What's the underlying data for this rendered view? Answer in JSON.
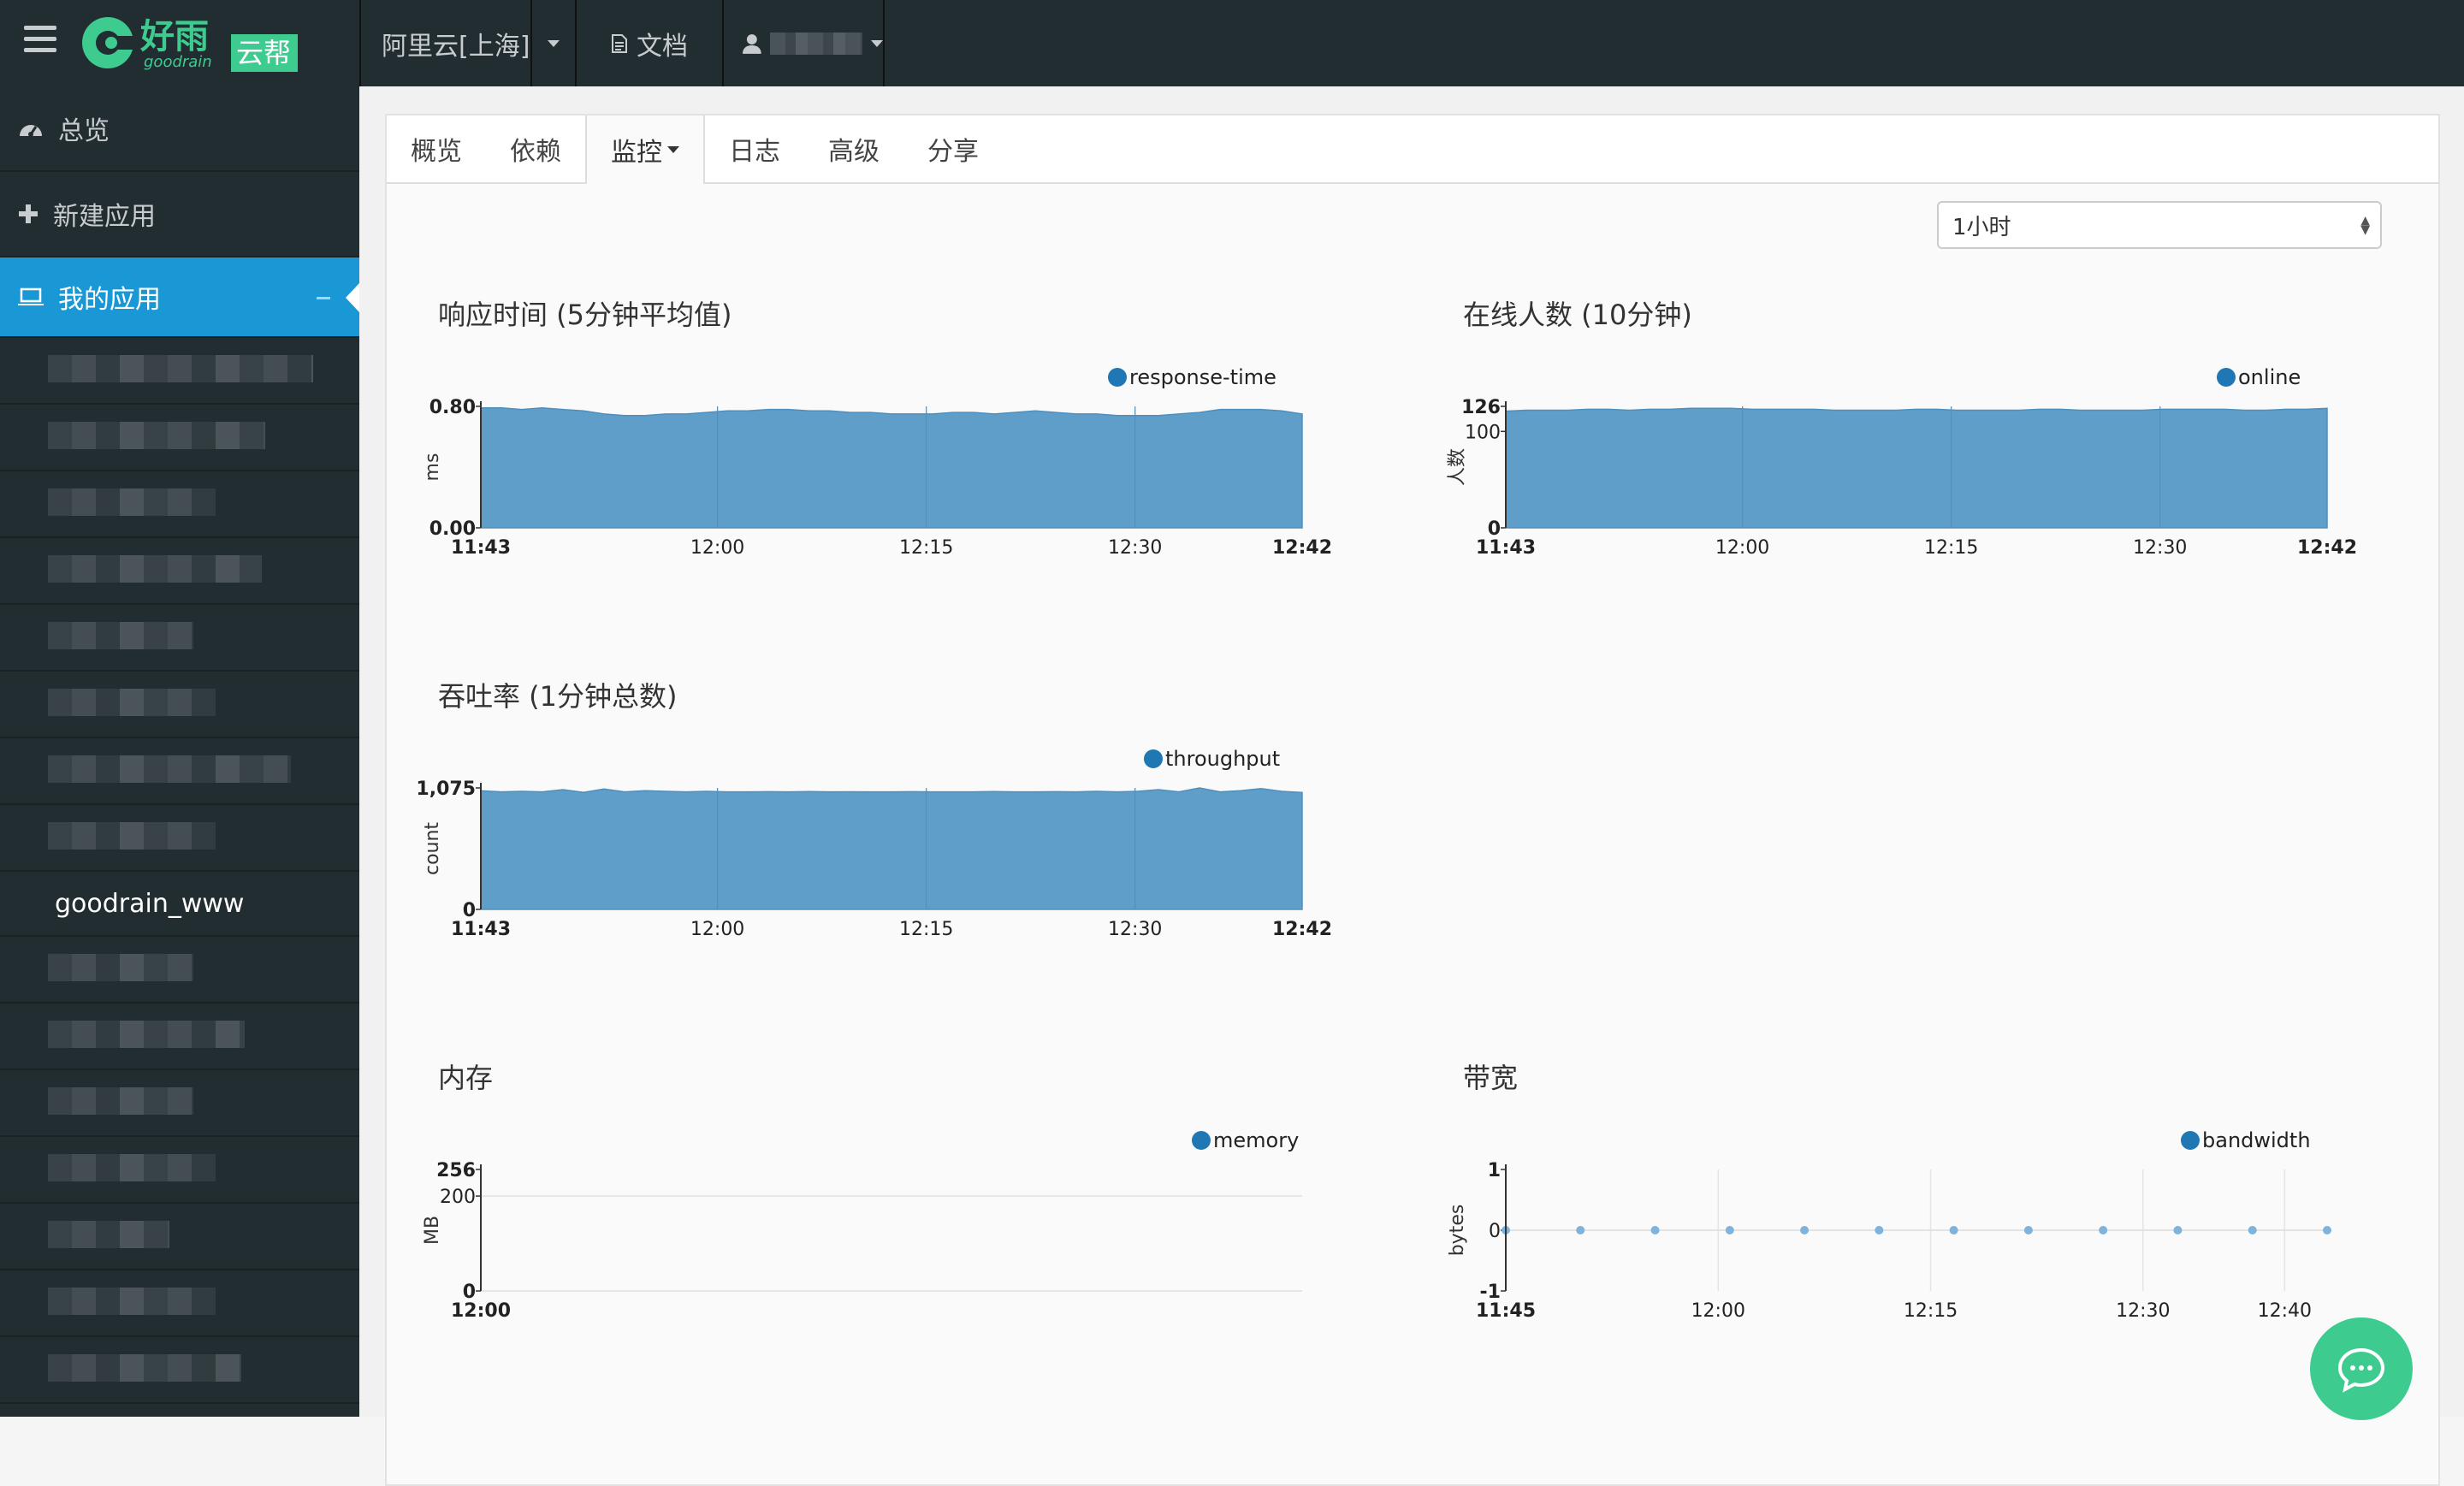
{
  "nav": {
    "region": "阿里云[上海]",
    "docs": "文档",
    "user": ""
  },
  "logo": {
    "text_cn": "好雨",
    "text_en": "goodrain",
    "badge": "云帮"
  },
  "sidebar": {
    "items": [
      {
        "label": "总览",
        "icon": "dashboard-icon"
      },
      {
        "label": "新建应用",
        "icon": "plus-icon"
      },
      {
        "label": "我的应用",
        "icon": "laptop-icon"
      }
    ],
    "visible_app": "goodrain_www"
  },
  "tabs": [
    {
      "label": "概览"
    },
    {
      "label": "依赖"
    },
    {
      "label": "监控"
    },
    {
      "label": "日志"
    },
    {
      "label": "高级"
    },
    {
      "label": "分享"
    }
  ],
  "time_range": {
    "selected": "1小时"
  },
  "colors": {
    "series": "#1f77b4",
    "area_fill": "#5f9ec8",
    "sidebar_active": "#1a98d5",
    "chat": "#3ecb8f"
  },
  "chart_data": [
    {
      "type": "area",
      "title": "响应时间 (5分钟平均值)",
      "ylabel": "ms",
      "legend": "response-time",
      "ylim": [
        0,
        0.8
      ],
      "y_ticks": [
        "0.80",
        "0.00"
      ],
      "x_ticks": [
        "11:43",
        "12:00",
        "12:15",
        "12:30",
        "12:42"
      ],
      "x_range_min": [
        703,
        762
      ],
      "series": [
        {
          "name": "response-time",
          "values": [
            0.79,
            0.79,
            0.78,
            0.79,
            0.78,
            0.77,
            0.75,
            0.74,
            0.74,
            0.75,
            0.75,
            0.76,
            0.77,
            0.77,
            0.78,
            0.78,
            0.77,
            0.77,
            0.76,
            0.76,
            0.75,
            0.75,
            0.75,
            0.76,
            0.76,
            0.75,
            0.76,
            0.77,
            0.76,
            0.75,
            0.75,
            0.74,
            0.74,
            0.74,
            0.75,
            0.76,
            0.78,
            0.78,
            0.78,
            0.77,
            0.75
          ]
        }
      ]
    },
    {
      "type": "area",
      "title": "在线人数 (10分钟)",
      "ylabel": "人数",
      "legend": "online",
      "ylim": [
        0,
        126
      ],
      "y_ticks": [
        "126",
        "100",
        "0"
      ],
      "x_ticks": [
        "11:43",
        "12:00",
        "12:15",
        "12:30",
        "12:42"
      ],
      "x_range_min": [
        703,
        762
      ],
      "series": [
        {
          "name": "online",
          "values": [
            121,
            122,
            122,
            122,
            123,
            123,
            122,
            123,
            123,
            124,
            124,
            124,
            123,
            123,
            123,
            123,
            122,
            122,
            122,
            122,
            123,
            123,
            122,
            122,
            122,
            122,
            123,
            123,
            122,
            122,
            122,
            122,
            123,
            123,
            123,
            123,
            122,
            122,
            123,
            123,
            124
          ]
        }
      ]
    },
    {
      "type": "area",
      "title": "吞吐率 (1分钟总数)",
      "ylabel": "count",
      "legend": "throughput",
      "ylim": [
        0,
        1075
      ],
      "y_ticks": [
        "1,075",
        "0"
      ],
      "x_ticks": [
        "11:43",
        "12:00",
        "12:15",
        "12:30",
        "12:42"
      ],
      "x_range_min": [
        703,
        762
      ],
      "series": [
        {
          "name": "throughput",
          "values": [
            1050,
            1040,
            1045,
            1040,
            1060,
            1035,
            1065,
            1040,
            1050,
            1045,
            1040,
            1045,
            1040,
            1040,
            1042,
            1040,
            1043,
            1040,
            1041,
            1040,
            1040,
            1042,
            1040,
            1040,
            1040,
            1043,
            1040,
            1040,
            1042,
            1040,
            1045,
            1040,
            1045,
            1060,
            1040,
            1075,
            1040,
            1050,
            1070,
            1045,
            1035
          ]
        }
      ]
    },
    {
      "type": "line",
      "title": "内存",
      "ylabel": "MB",
      "legend": "memory",
      "ylim": [
        0,
        256
      ],
      "y_ticks": [
        "256",
        "200",
        "0"
      ],
      "x_ticks": [
        "12:00"
      ],
      "series": [
        {
          "name": "memory",
          "values": []
        }
      ]
    },
    {
      "type": "scatter",
      "title": "带宽",
      "ylabel": "bytes",
      "legend": "bandwidth",
      "ylim": [
        -1,
        1
      ],
      "y_ticks": [
        "1",
        "0",
        "-1"
      ],
      "x_ticks": [
        "11:45",
        "12:00",
        "12:15",
        "12:30",
        "12:40"
      ],
      "series": [
        {
          "name": "bandwidth",
          "values": [
            0,
            0,
            0,
            0,
            0,
            0,
            0,
            0,
            0,
            0,
            0,
            0
          ]
        }
      ]
    }
  ]
}
